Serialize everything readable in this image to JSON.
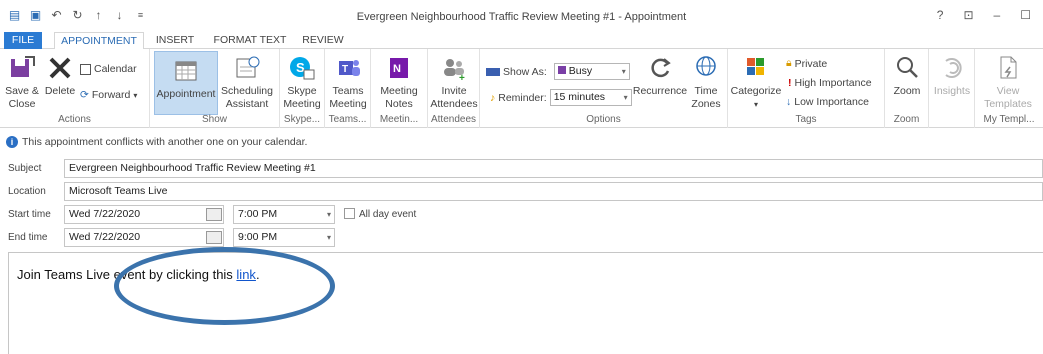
{
  "window": {
    "title": "Evergreen Neighbourhood Traffic Review Meeting #1 - Appointment",
    "controls": [
      "?",
      "⊡",
      "–",
      "☐"
    ]
  },
  "tabs": [
    "FILE",
    "APPOINTMENT",
    "INSERT",
    "FORMAT TEXT",
    "REVIEW"
  ],
  "ribbon": {
    "actions": {
      "save_close": "Save &\nClose",
      "delete": "Delete",
      "calendar": "Calendar",
      "forward": "Forward",
      "label": "Actions"
    },
    "show": {
      "appointment": "Appointment",
      "scheduling": "Scheduling\nAssistant",
      "label": "Show"
    },
    "skype": {
      "btn": "Skype\nMeeting",
      "label": "Skype..."
    },
    "teams": {
      "btn": "Teams\nMeeting",
      "label": "Teams..."
    },
    "notes": {
      "btn": "Meeting\nNotes",
      "label": "Meetin..."
    },
    "attendees": {
      "btn": "Invite\nAttendees",
      "label": "Attendees"
    },
    "options": {
      "show_as_label": "Show As:",
      "show_as_value": "Busy",
      "reminder_label": "Reminder:",
      "reminder_value": "15 minutes",
      "recurrence": "Recurrence",
      "time_zones": "Time\nZones",
      "label": "Options"
    },
    "tags": {
      "categorize": "Categorize",
      "private": "Private",
      "high": "High Importance",
      "low": "Low Importance",
      "label": "Tags"
    },
    "zoom": {
      "btn": "Zoom",
      "label": "Zoom"
    },
    "insights": {
      "btn": "Insights"
    },
    "templates": {
      "btn": "View\nTemplates",
      "label": "My Templ..."
    }
  },
  "info": "This appointment conflicts with another one on your calendar.",
  "form": {
    "subject_label": "Subject",
    "subject_value": "Evergreen Neighbourhood Traffic Review Meeting #1",
    "location_label": "Location",
    "location_value": "Microsoft Teams Live",
    "start_label": "Start time",
    "start_date": "Wed 7/22/2020",
    "start_time": "7:00 PM",
    "all_day": "All day event",
    "end_label": "End time",
    "end_date": "Wed 7/22/2020",
    "end_time": "9:00 PM"
  },
  "body": {
    "text_before": "Join Teams Live event by clicking this ",
    "link": "link",
    "text_after": "."
  }
}
